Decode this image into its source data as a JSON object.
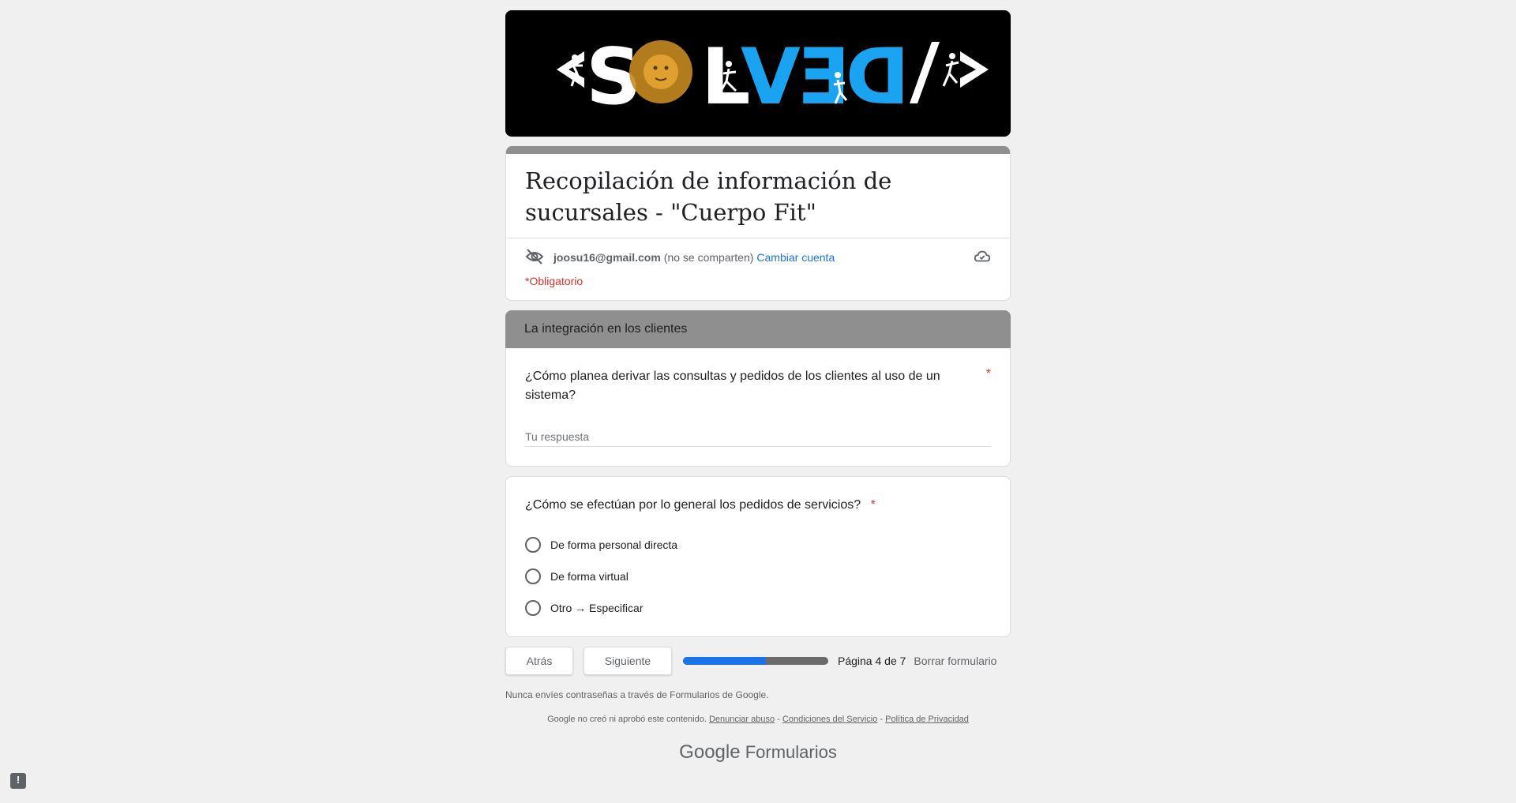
{
  "banner": {
    "logo_text": "<SOLVED/>",
    "colors": {
      "bg": "#000000",
      "white": "#ffffff",
      "blue": "#1aa3f0",
      "sun": "#e0a020"
    }
  },
  "form": {
    "title": "Recopilación de información de sucursales - \"Cuerpo Fit\"",
    "account_email": "joosu16@gmail.com",
    "account_note": "(no se comparten)",
    "switch_account": "Cambiar cuenta",
    "required_note": "*Obligatorio"
  },
  "section": {
    "title": "La integración en los clientes"
  },
  "questions": [
    {
      "text": "¿Cómo planea derivar las consultas y pedidos de los clientes al uso de un sistema?",
      "required_mark": "*",
      "placeholder": "Tu respuesta"
    },
    {
      "text": "¿Cómo se efectúan por lo general los pedidos de servicios?",
      "required_mark": "*",
      "options": [
        "De forma personal directa",
        "De forma virtual",
        "Otro → Especificar"
      ]
    }
  ],
  "nav": {
    "back_label": "Atrás",
    "next_label": "Siguiente",
    "progress_fraction": 0.57,
    "page_info": "Página 4 de 7",
    "clear_label": "Borrar formulario"
  },
  "footer": {
    "password_warning": "Nunca envíes contraseñas a través de Formularios de Google.",
    "disclaimer": "Google no creó ni aprobó este contenido.",
    "report_abuse": "Denunciar abuso",
    "terms": "Condiciones del Servicio",
    "privacy": "Política de Privacidad",
    "brand_google": "Google",
    "brand_forms": "Formularios"
  },
  "colors": {
    "accent": "#1a73e8",
    "required": "#d93025",
    "header_gray": "#8f8f8f",
    "page_bg": "#f0f0f0"
  }
}
